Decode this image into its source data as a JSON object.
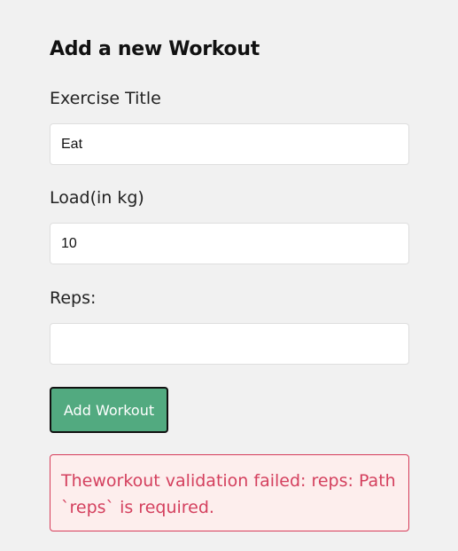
{
  "form": {
    "heading": "Add a new Workout",
    "fields": [
      {
        "label": "Exercise Title",
        "value": "Eat",
        "placeholder": ""
      },
      {
        "label": "Load(in kg)",
        "value": "10",
        "placeholder": ""
      },
      {
        "label": "Reps:",
        "value": "",
        "placeholder": ""
      }
    ],
    "submit_label": "Add Workout"
  },
  "error": {
    "message": "Theworkout validation failed: reps: Path `reps` is required."
  },
  "colors": {
    "background": "#f1f1f1",
    "button": "#52aa80",
    "error_text": "#d4405e",
    "error_bg": "#fdeeed",
    "error_border": "#d63d5a"
  }
}
